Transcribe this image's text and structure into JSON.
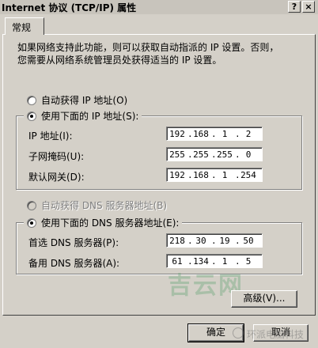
{
  "window": {
    "title": "Internet 协议 (TCP/IP) 属性",
    "help_button": "?",
    "close_button": "×"
  },
  "tabs": [
    {
      "label": "常规",
      "selected": true
    }
  ],
  "description": {
    "line1": "如果网络支持此功能，则可以获取自动指派的 IP 设置。否则，",
    "line2": "您需要从网络系统管理员处获得适当的 IP 设置。"
  },
  "ip_mode": {
    "auto_label": "自动获得 IP 地址(O)",
    "manual_label": "使用下面的 IP 地址(S):",
    "selected": "manual"
  },
  "ip_fields": [
    {
      "label": "IP 地址(I):",
      "octets": [
        "192",
        "168",
        "1",
        "2"
      ]
    },
    {
      "label": "子网掩码(U):",
      "octets": [
        "255",
        "255",
        "255",
        "0"
      ]
    },
    {
      "label": "默认网关(D):",
      "octets": [
        "192",
        "168",
        "1",
        "254"
      ]
    }
  ],
  "dns_mode": {
    "auto_label": "自动获得 DNS 服务器地址(B)",
    "manual_label": "使用下面的 DNS 服务器地址(E):",
    "selected": "manual",
    "auto_disabled": true
  },
  "dns_fields": [
    {
      "label": "首选 DNS 服务器(P):",
      "octets": [
        "218",
        "30",
        "19",
        "50"
      ]
    },
    {
      "label": "备用 DNS 服务器(A):",
      "octets": [
        "61",
        "134",
        "1",
        "5"
      ]
    }
  ],
  "buttons": {
    "advanced": "高级(V)...",
    "ok": "确定",
    "cancel": "取消"
  },
  "watermark": {
    "logo_text": "吉云网",
    "overlay_text": "环派电脑科技"
  }
}
